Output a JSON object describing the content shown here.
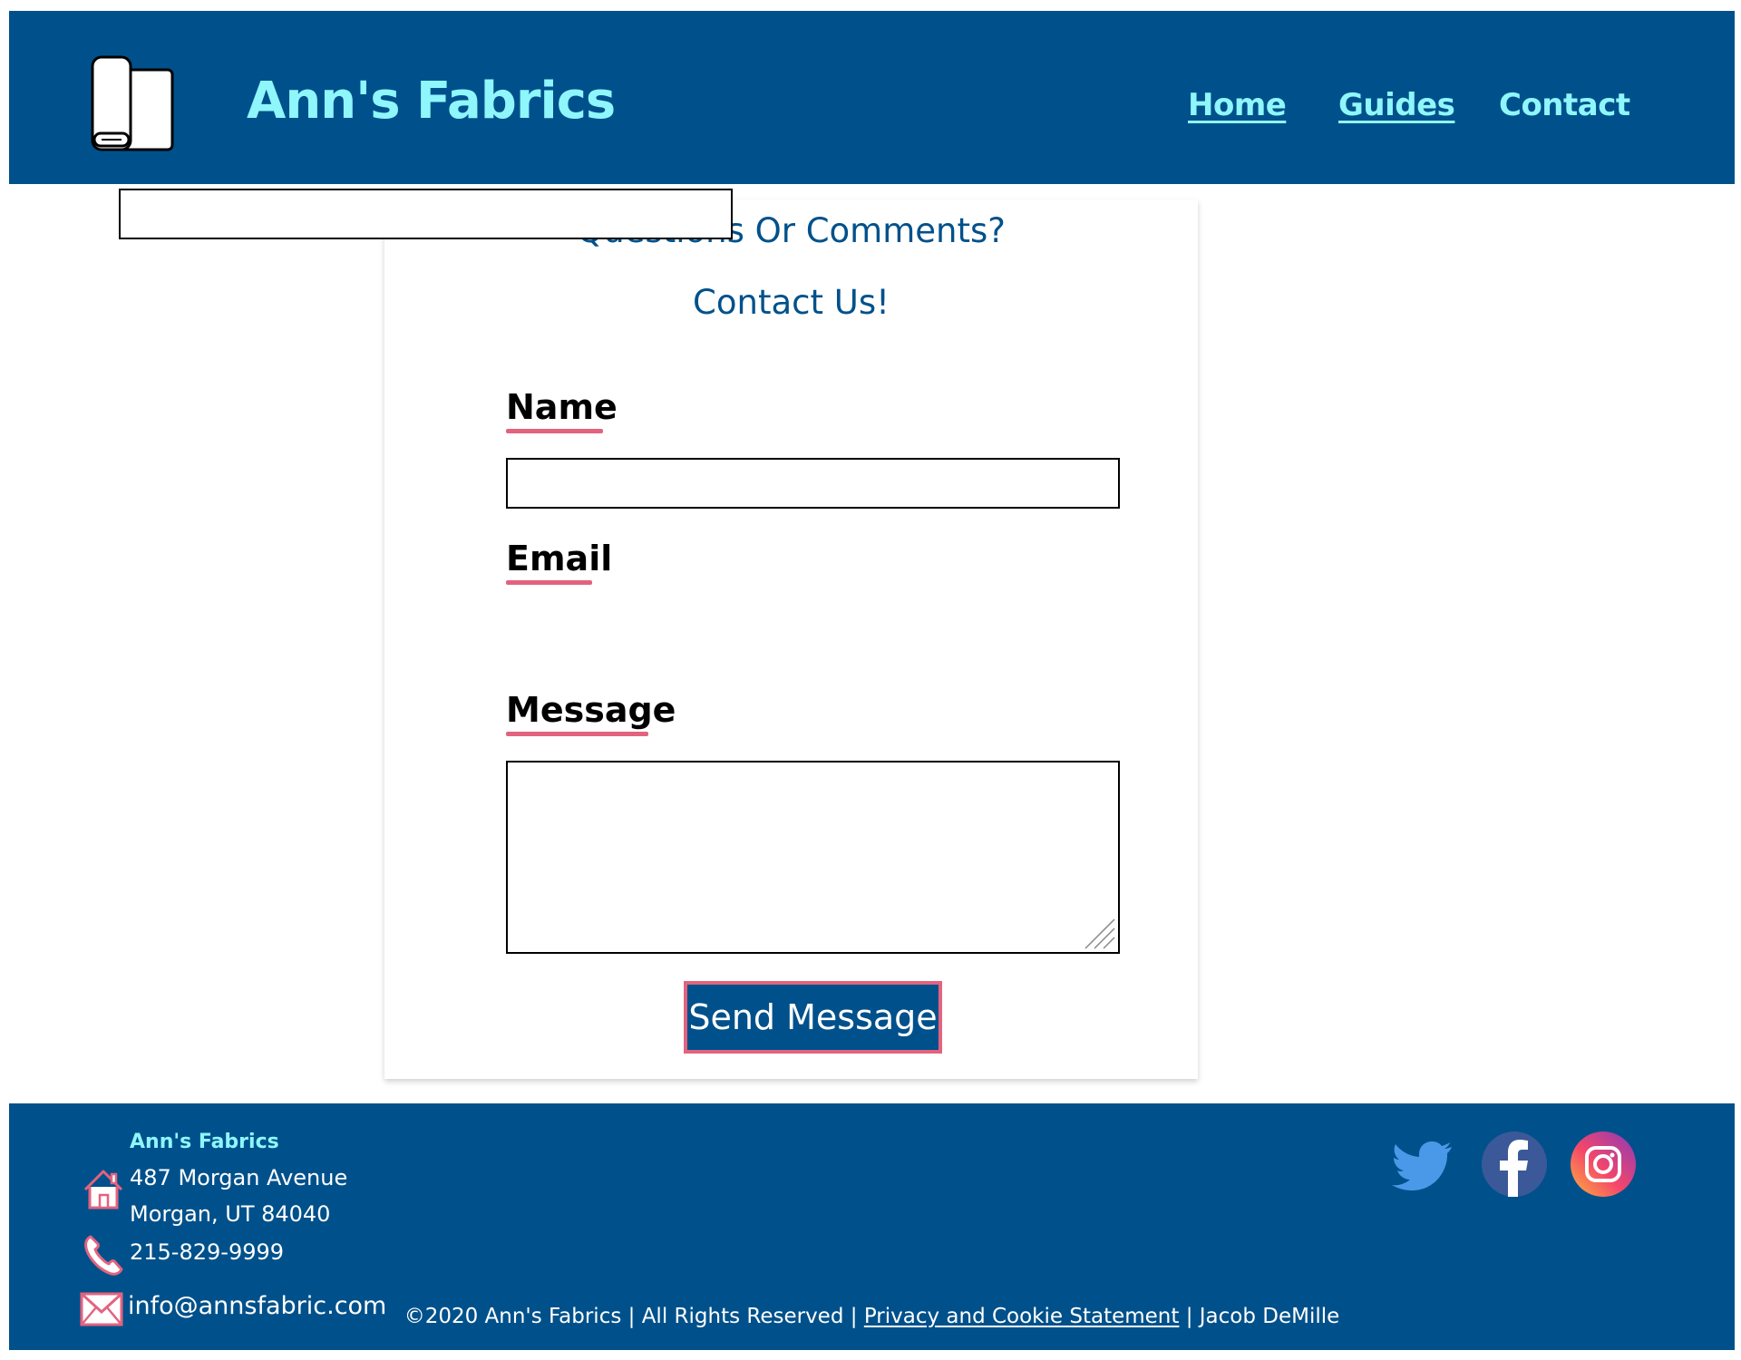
{
  "header": {
    "site_title": "Ann's Fabrics",
    "logo_icon": "fabric-roll-icon",
    "nav": {
      "home": "Home",
      "guides": "Guides",
      "contact": "Contact"
    }
  },
  "form": {
    "heading_line1": "Questions Or Comments?",
    "heading_line2": "Contact Us!",
    "name_label": "Name",
    "name_value": "",
    "email_label": "Email",
    "email_value": "",
    "message_label": "Message",
    "message_value": "",
    "submit_label": "Send Message"
  },
  "footer": {
    "company": "Ann's Fabrics",
    "street": "487 Morgan Avenue",
    "city": "Morgan, UT 84040",
    "phone": "215-829-9999",
    "email": "info@annsfabric.com",
    "copyright_prefix": "©2020 Ann's Fabrics | All Rights Reserved | ",
    "privacy_link": "Privacy and Cookie Statement",
    "copyright_suffix": " | Jacob DeMille",
    "social": [
      "twitter-icon",
      "facebook-icon",
      "instagram-icon"
    ]
  },
  "colors": {
    "primary": "#00518b",
    "accent_cyan": "#8ff6fb",
    "accent_pink": "#e3637f",
    "twitter": "#4a99e9",
    "facebook": "#3b5998"
  }
}
